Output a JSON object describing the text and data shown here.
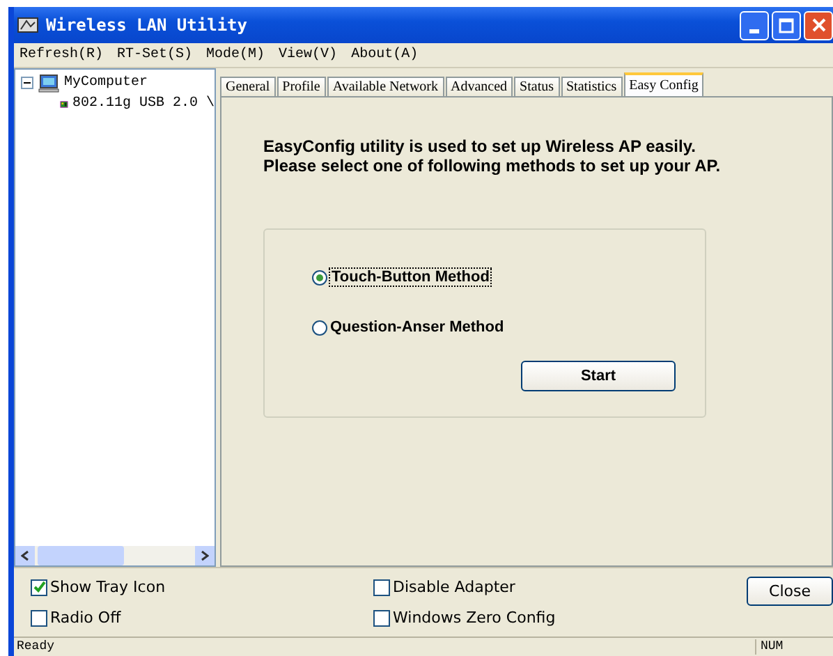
{
  "window": {
    "title": "Wireless LAN Utility"
  },
  "menu": [
    {
      "label": "Refresh(R)"
    },
    {
      "label": "RT-Set(S)"
    },
    {
      "label": "Mode(M)"
    },
    {
      "label": "View(V)"
    },
    {
      "label": "About(A)"
    }
  ],
  "tree": [
    {
      "label": "MyComputer",
      "expanded": true,
      "children": [
        {
          "label": "802.11g USB 2.0 \\"
        }
      ]
    }
  ],
  "tabs": [
    {
      "label": "General",
      "selected": false
    },
    {
      "label": "Profile",
      "selected": false
    },
    {
      "label": "Available Network",
      "selected": false
    },
    {
      "label": "Advanced",
      "selected": false
    },
    {
      "label": "Status",
      "selected": false
    },
    {
      "label": "Statistics",
      "selected": false
    },
    {
      "label": "Easy Config",
      "selected": true
    }
  ],
  "easy_config": {
    "intro": "EasyConfig utility is used to set up Wireless AP easily.\nPlease select one of following methods to set up your AP.",
    "methods": [
      {
        "label": "Touch-Button Method",
        "selected": true
      },
      {
        "label": "Question-Anser Method",
        "selected": false
      }
    ],
    "start_button": "Start"
  },
  "options": [
    {
      "label": "Show Tray Icon",
      "checked": true
    },
    {
      "label": "Disable Adapter",
      "checked": false
    },
    {
      "label": "Radio Off",
      "checked": false
    },
    {
      "label": "Windows Zero Config",
      "checked": false
    }
  ],
  "close_button": "Close",
  "status_bar": {
    "text": "Ready",
    "indicator": "NUM"
  }
}
